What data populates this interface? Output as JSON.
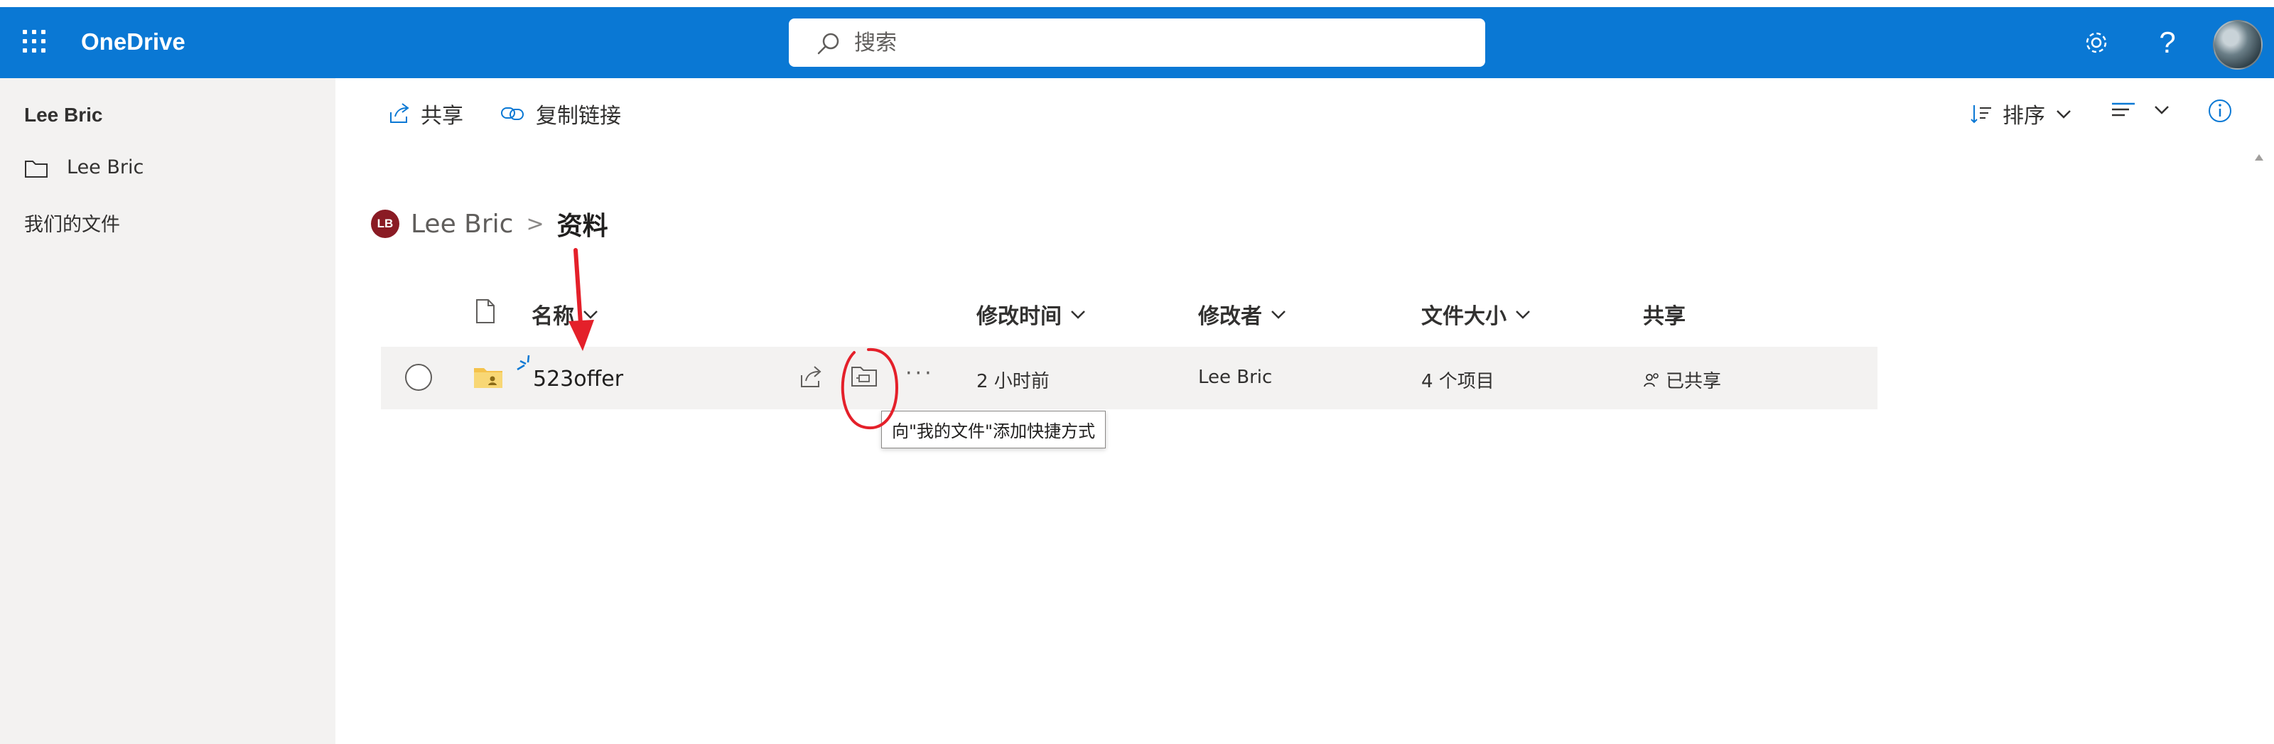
{
  "app": {
    "name": "OneDrive"
  },
  "search": {
    "placeholder": "搜索"
  },
  "sidebar": {
    "user": "Lee Bric",
    "items": [
      {
        "label": "Lee Bric",
        "icon": "folder-icon"
      },
      {
        "label": "我们的文件"
      }
    ]
  },
  "commands": {
    "share": "共享",
    "copy_link": "复制链接",
    "sort": "排序"
  },
  "breadcrumb": {
    "avatar_initials": "LB",
    "root": "Lee Bric",
    "separator": ">",
    "current": "资料"
  },
  "columns": {
    "name": "名称",
    "modified": "修改时间",
    "modified_by": "修改者",
    "size": "文件大小",
    "sharing": "共享"
  },
  "files": [
    {
      "name": "523offer",
      "modified": "2 小时前",
      "modified_by": "Lee Bric",
      "size": "4 个项目",
      "sharing": "已共享"
    }
  ],
  "tooltip": {
    "text": "向\"我的文件\"添加快捷方式"
  },
  "colors": {
    "brand_blue": "#0a78d4",
    "sidebar_bg": "#f3f2f1",
    "annotation_red": "#e4202a",
    "avatar_bg": "#8a1b24",
    "folder_yellow": "#f4c24b"
  }
}
